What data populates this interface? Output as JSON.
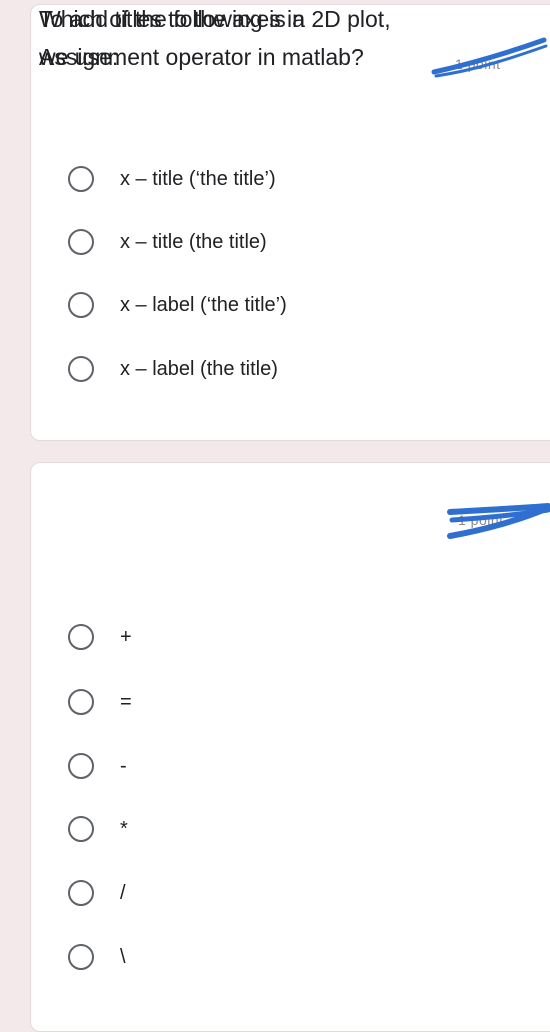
{
  "questions": [
    {
      "text": "To add titles to the axes in 2D plot, we use:",
      "points": "1 point",
      "options": [
        "x – title (‘the title’)",
        "x – title (the title)",
        "x – label (‘the title’)",
        "x – label (the title)"
      ]
    },
    {
      "text": "Which of the following is a Assignment operator in matlab?",
      "points": "1 point",
      "options": [
        "+",
        "=",
        "-",
        "*",
        "/",
        "\\"
      ]
    }
  ],
  "colors": {
    "page_background": "#f3e9ea",
    "card_background": "#ffffff",
    "scribble": "#2f6fd0",
    "radio_border": "#5f6368"
  }
}
